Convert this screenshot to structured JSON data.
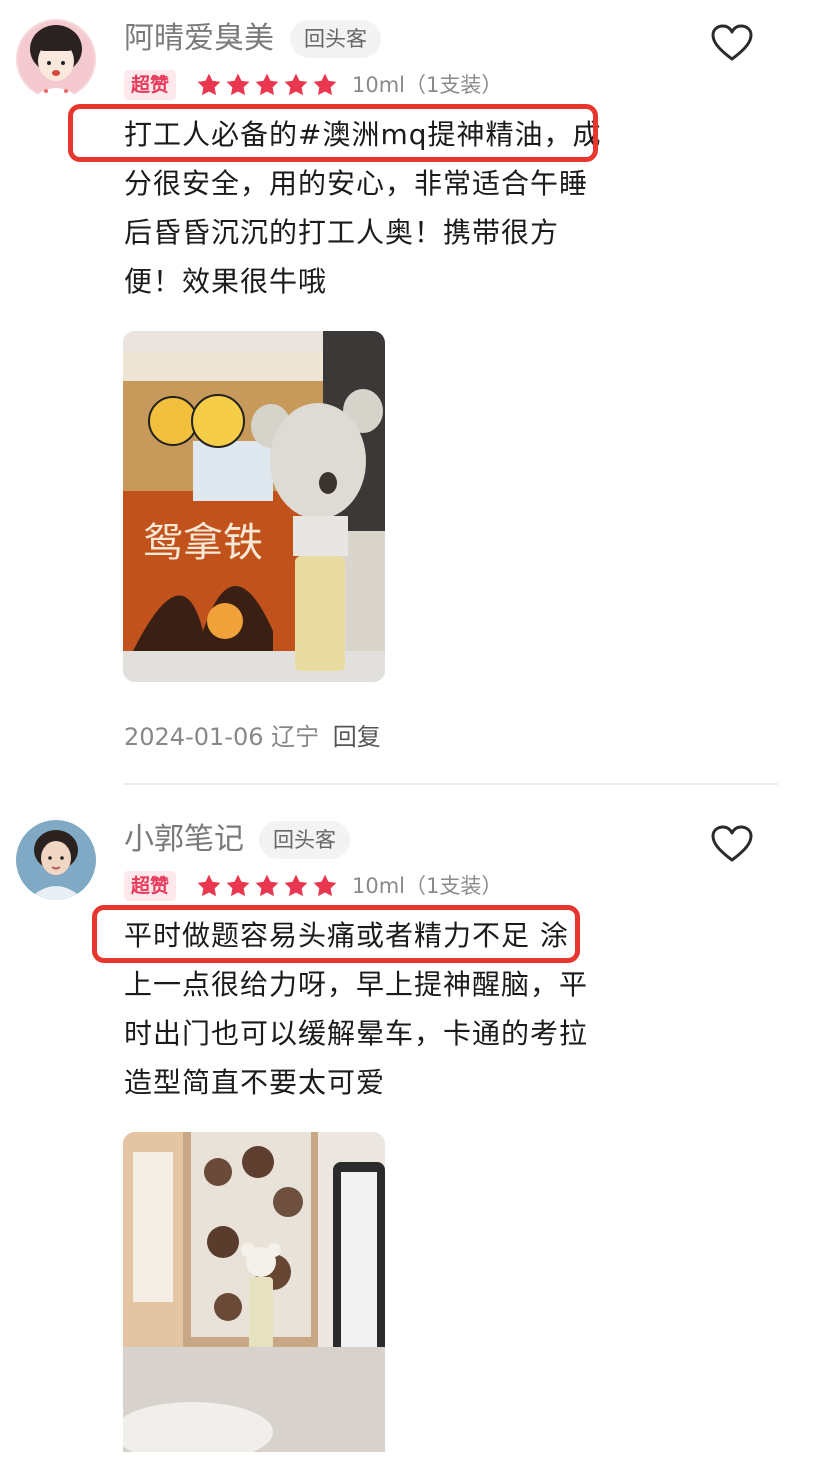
{
  "reviews": [
    {
      "username": "阿晴爱臭美",
      "return_badge": "回头客",
      "rating_badge": "超赞",
      "stars": 5,
      "spec": "10ml（1支装）",
      "lines": [
        "打工人必备的#澳洲mq提神精油，成",
        "分很安全，用的安心，非常适合午睡",
        "后昏昏沉沉的打工人奥！携带很方",
        "便！效果很牛哦"
      ],
      "date": "2024-01-06",
      "location": "辽宁",
      "reply_label": "回复"
    },
    {
      "username": "小郭笔记",
      "return_badge": "回头客",
      "rating_badge": "超赞",
      "stars": 5,
      "spec": "10ml（1支装）",
      "lines": [
        "平时做题容易头痛或者精力不足 涂",
        "上一点很给力呀，早上提神醒脑，平",
        "时出门也可以缓解晕车，卡通的考拉",
        "造型简直不要太可爱"
      ]
    }
  ],
  "colors": {
    "accent_red": "#e6362d",
    "star": "#e8374e",
    "badge_bg": "#fde8ec"
  },
  "icons": [
    "heart-icon",
    "star-icon"
  ]
}
